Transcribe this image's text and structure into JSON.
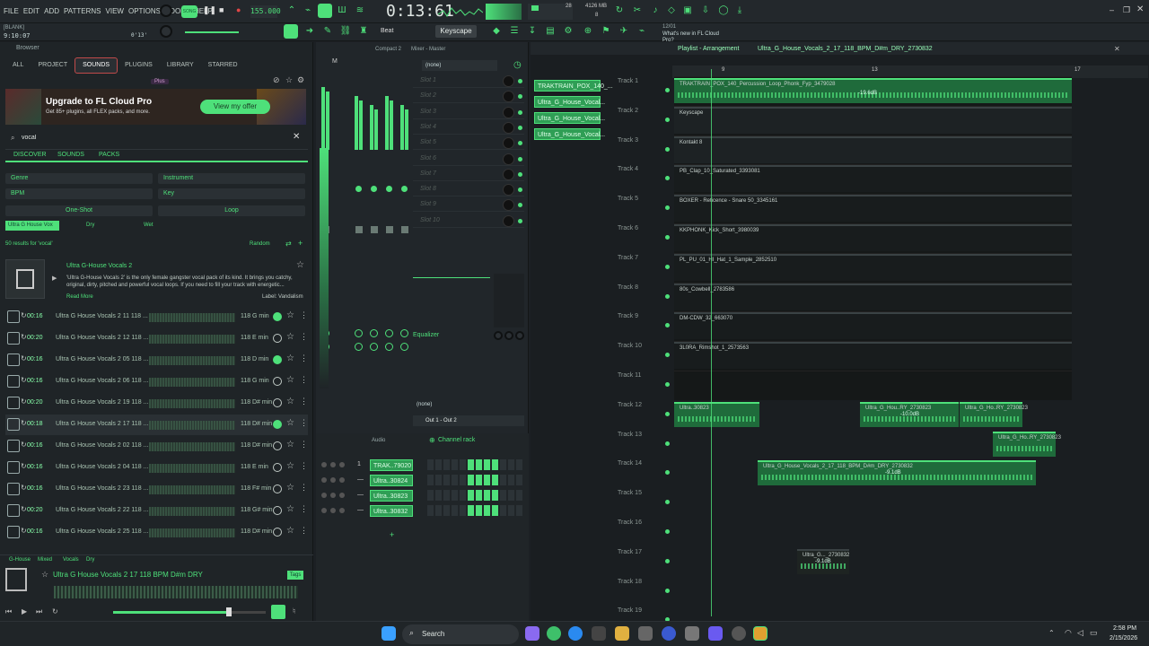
{
  "menu": [
    "FILE",
    "EDIT",
    "ADD",
    "PATTERNS",
    "VIEW",
    "OPTIONS",
    "TOOLS",
    "HELP"
  ],
  "tempo": "155.000",
  "time": "0:13:61",
  "cpu": "28",
  "mem": "4126 MB",
  "voices": "8",
  "project_info": "[BLANK]",
  "project_time": "9:10:07",
  "snap_time": "0'13'",
  "preset_label": "Keyscape",
  "beat_label": "Beat",
  "news_date": "12/01",
  "news_text": "What's new in FL Cloud Pro?",
  "browser": {
    "title": "Browser",
    "tabs": [
      "ALL",
      "PROJECT",
      "SOUNDS",
      "PLUGINS",
      "LIBRARY",
      "STARRED"
    ],
    "plus": "Plus",
    "promo_title": "Upgrade to FL Cloud Pro",
    "promo_sub": "Get 85+ plugins, all FLEX packs, and more.",
    "promo_btn": "View my offer",
    "search": "vocal",
    "subtabs": [
      "DISCOVER",
      "SOUNDS",
      "PACKS"
    ],
    "filters": [
      "Genre",
      "Instrument",
      "BPM",
      "Key"
    ],
    "types": [
      "One-Shot",
      "Loop"
    ],
    "tags": [
      "Ultra G House Vox",
      "Dry",
      "Wet"
    ],
    "results": "50 results for 'vocal'",
    "sort": "Random",
    "pack_title": "Ultra G-House Vocals 2",
    "pack_desc": "'Ultra G-House Vocals 2' is the only female gangster vocal pack of its kind. It brings you catchy, original, dirty, pitched and powerful vocal loops. If you need to fill your track with energetic...",
    "read_more": "Read More",
    "label": "Label: Vandalism",
    "items": [
      {
        "t": "00:16",
        "n": "Ultra G House Vocals 2 11 118 ...",
        "b": "118",
        "k": "G min",
        "c": true
      },
      {
        "t": "00:20",
        "n": "Ultra G House Vocals 2 12 118 ...",
        "b": "118",
        "k": "E min",
        "c": false
      },
      {
        "t": "00:16",
        "n": "Ultra G House Vocals 2 05 118 ...",
        "b": "118",
        "k": "D min",
        "c": true
      },
      {
        "t": "00:16",
        "n": "Ultra G House Vocals 2 06 118 ...",
        "b": "118",
        "k": "G min",
        "c": false
      },
      {
        "t": "00:20",
        "n": "Ultra G House Vocals 2 19 118 ...",
        "b": "118",
        "k": "D# min",
        "c": false
      },
      {
        "t": "00:18",
        "n": "Ultra G House Vocals 2 17 118 ...",
        "b": "118",
        "k": "D# min",
        "c": true
      },
      {
        "t": "00:16",
        "n": "Ultra G House Vocals 2 02 118 ...",
        "b": "118",
        "k": "D# min",
        "c": false
      },
      {
        "t": "00:16",
        "n": "Ultra G House Vocals 2 04 118 ...",
        "b": "118",
        "k": "E min",
        "c": false
      },
      {
        "t": "00:16",
        "n": "Ultra G House Vocals 2 23 118 ...",
        "b": "118",
        "k": "F# min",
        "c": false
      },
      {
        "t": "00:20",
        "n": "Ultra G House Vocals 2 22 118 ...",
        "b": "118",
        "k": "G# min",
        "c": false
      },
      {
        "t": "00:16",
        "n": "Ultra G House Vocals 2 25 118 ...",
        "b": "118",
        "k": "D# min",
        "c": false
      }
    ],
    "footer_tags": [
      "G-House",
      "Mixed",
      "Vocals",
      "Dry"
    ],
    "now_playing": "Ultra G House Vocals 2 17 118 BPM D#m DRY",
    "tags_btn": "Tags"
  },
  "mixer": {
    "title": "Compact 2",
    "subtitle": "Mixer - Master",
    "master_label": "M",
    "insert_label": "(none)",
    "slots": [
      "Slot 1",
      "Slot 2",
      "Slot 3",
      "Slot 4",
      "Slot 5",
      "Slot 6",
      "Slot 7",
      "Slot 8",
      "Slot 9",
      "Slot 10"
    ],
    "eq_label": "Equalizer",
    "none2": "(none)",
    "out": "Out 1 - Out 2"
  },
  "chanrack": {
    "title": "Channel rack",
    "audio": "Audio",
    "channels": [
      "TRAK..79020",
      "Ultra..30824",
      "Ultra..30823",
      "Ultra..30832"
    ],
    "nums": [
      "1",
      "—",
      "—",
      "—"
    ]
  },
  "picker": [
    "TRAKTRAIN_POX_140_...",
    "Ultra_G_House_Vocal...",
    "Ultra_G_House_Vocal...",
    "Ultra_G_House_Vocal..."
  ],
  "playlist": {
    "title": "Playlist - Arrangement",
    "crumb": "Ultra_G_House_Vocals_2_17_118_BPM_D#m_DRY_2730832",
    "ruler": [
      "9",
      "13",
      "17"
    ],
    "tracks": [
      "Track 1",
      "Track 2",
      "Track 3",
      "Track 4",
      "Track 5",
      "Track 6",
      "Track 7",
      "Track 8",
      "Track 9",
      "Track 10",
      "Track 11",
      "Track 12",
      "Track 13",
      "Track 14",
      "Track 15",
      "Track 16",
      "Track 17",
      "Track 18",
      "Track 19"
    ],
    "clips": {
      "t1": "TRAKTRAIN_POX_140_Percussion_Loop_Phonk_Fyp_3479028",
      "t1db": "-19.6dB",
      "t2": "Keyscape",
      "t3": "Kontakt 8",
      "t4": "PB_Clap_10_Saturated_3393081",
      "t5": "BOXER - Reticence - Snare 50_3345161",
      "t6": "KKPHONK_Kick_Short_3980039",
      "t7": "PL_PU_01_HI_Hat_1_Sample_2852510",
      "t8": "80s_Cowbell_2783586",
      "t9": "DM-CDW_32_663070",
      "t10": "3L0RA_Rimshot_1_2573563",
      "t12a": "Ultra..30823",
      "t12b": "Ultra_G_Hou..RY_2730823",
      "t12c": "Ultra_G_Ho..RY_2730823",
      "t12db": "-10.0dB",
      "t13": "Ultra_G_Ho..RY_2730823",
      "t14": "Ultra_G_House_Vocals_2_17_118_BPM_D#m_DRY_2730832",
      "t14db": "-9.1dB",
      "t17": "Ultra_G..._2730832",
      "t17db": "-9.1dB"
    }
  },
  "taskbar": {
    "search": "Search",
    "clock": "2:58 PM",
    "date": "2/15/2026"
  },
  "colors": {
    "accent": "#4ee07a",
    "bg": "#1c2024"
  }
}
